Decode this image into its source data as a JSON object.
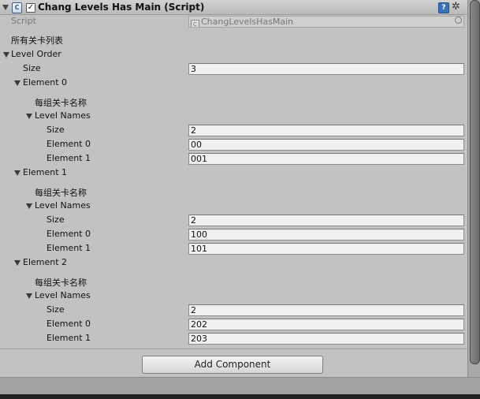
{
  "header": {
    "title": "Chang Levels Has Main (Script)",
    "enabled": true,
    "script_icon_glyph": "C",
    "help_glyph": "?",
    "gear_glyph": "✲"
  },
  "script_field": {
    "label": "Script",
    "value": "ChangLevelsHasMain"
  },
  "header_label": "所有关卡列表",
  "level_order": {
    "label": "Level Order",
    "size_label": "Size",
    "size": "3",
    "elements": [
      {
        "label": "Element 0",
        "section_header": "每组关卡名称",
        "level_names_label": "Level Names",
        "size_label": "Size",
        "size": "2",
        "items": [
          {
            "label": "Element 0",
            "value": "00"
          },
          {
            "label": "Element 1",
            "value": "001"
          }
        ]
      },
      {
        "label": "Element 1",
        "section_header": "每组关卡名称",
        "level_names_label": "Level Names",
        "size_label": "Size",
        "size": "2",
        "items": [
          {
            "label": "Element 0",
            "value": "100"
          },
          {
            "label": "Element 1",
            "value": "101"
          }
        ]
      },
      {
        "label": "Element 2",
        "section_header": "每组关卡名称",
        "level_names_label": "Level Names",
        "size_label": "Size",
        "size": "2",
        "items": [
          {
            "label": "Element 0",
            "value": "202"
          },
          {
            "label": "Element 1",
            "value": "203"
          }
        ]
      }
    ]
  },
  "add_component_label": "Add Component",
  "colors": {
    "background": "#c2c2c2",
    "field": "#f0f0f0",
    "accent": "#3a72b8"
  }
}
